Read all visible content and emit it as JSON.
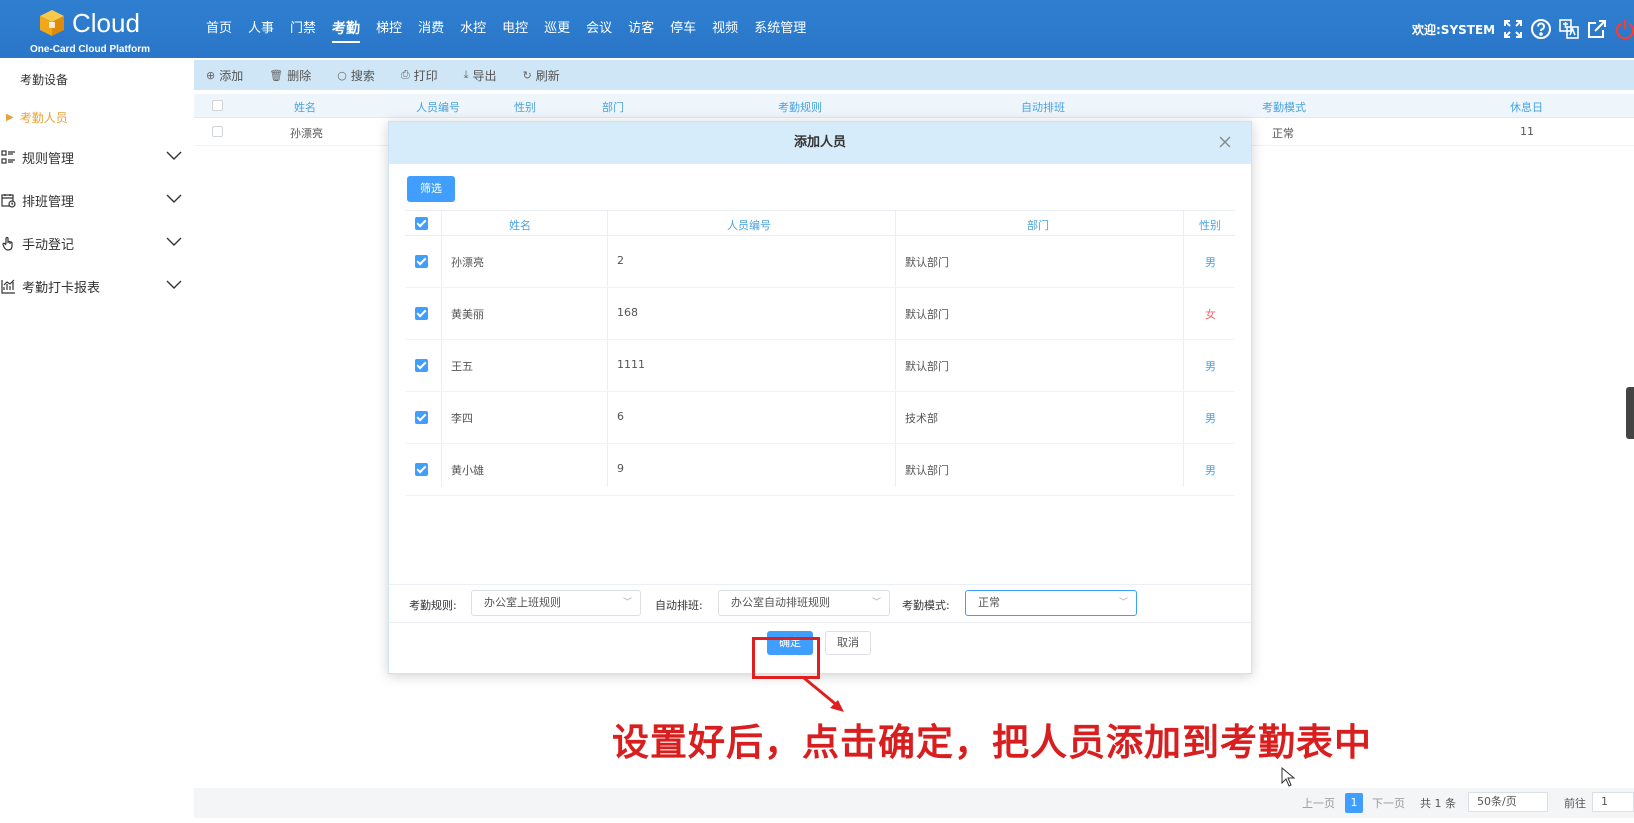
{
  "app": {
    "logo_text": "Cloud",
    "logo_subtitle": "One-Card Cloud Platform",
    "welcome": "欢迎:SYSTEM"
  },
  "nav": {
    "items": [
      "首页",
      "人事",
      "门禁",
      "考勤",
      "梯控",
      "消费",
      "水控",
      "电控",
      "巡更",
      "会议",
      "访客",
      "停车",
      "视频",
      "系统管理"
    ],
    "active": "考勤"
  },
  "header_icons": [
    "fullscreen-icon",
    "help-icon",
    "translate-icon",
    "external-link-icon",
    "power-icon"
  ],
  "sidebar": {
    "items": [
      {
        "label": "考勤设备",
        "type": "sub"
      },
      {
        "label": "考勤人员",
        "type": "sub",
        "active": true
      },
      {
        "label": "规则管理",
        "type": "group",
        "icon": "rules-icon"
      },
      {
        "label": "排班管理",
        "type": "group",
        "icon": "schedule-icon"
      },
      {
        "label": "手动登记",
        "type": "group",
        "icon": "hand-icon"
      },
      {
        "label": "考勤打卡报表",
        "type": "group",
        "icon": "report-chart-icon"
      }
    ]
  },
  "toolbar": {
    "add": "添加",
    "delete": "删除",
    "search": "搜索",
    "print": "打印",
    "export": "导出",
    "refresh": "刷新"
  },
  "grid": {
    "headers": {
      "name": "姓名",
      "id": "人员编号",
      "gender": "性别",
      "dept": "部门",
      "rule": "考勤规则",
      "auto": "自动排班",
      "mode": "考勤模式",
      "rest": "休息日"
    },
    "row": {
      "name": "孙漂亮",
      "mode": "正常",
      "rest": "11"
    }
  },
  "pager": {
    "prev": "上一页",
    "current": "1",
    "next": "下一页",
    "total": "共 1 条",
    "page_size": "50条/页",
    "goto": "前往",
    "goto_value": "1"
  },
  "dialog": {
    "title": "添加人员",
    "filter_button": "筛选",
    "headers": {
      "name": "姓名",
      "id": "人员编号",
      "dept": "部门",
      "gender": "性别"
    },
    "rows": [
      {
        "name": "孙漂亮",
        "id": "2",
        "dept": "默认部门",
        "gender": "男",
        "checked": true
      },
      {
        "name": "黄美丽",
        "id": "168",
        "dept": "默认部门",
        "gender": "女",
        "checked": true
      },
      {
        "name": "王五",
        "id": "1111",
        "dept": "默认部门",
        "gender": "男",
        "checked": true
      },
      {
        "name": "李四",
        "id": "6",
        "dept": "技术部",
        "gender": "男",
        "checked": true
      },
      {
        "name": "黄小雄",
        "id": "9",
        "dept": "默认部门",
        "gender": "男",
        "checked": true
      }
    ],
    "rule_label": "考勤规则:",
    "rule_value": "办公室上班规则",
    "auto_label": "自动排班:",
    "auto_value": "办公室自动排班规则",
    "mode_label": "考勤模式:",
    "mode_value": "正常",
    "ok": "确定",
    "cancel": "取消"
  },
  "annotation": "设置好后，点击确定，把人员添加到考勤表中",
  "colors": {
    "header_blue": "#2f7fd1",
    "primary": "#409eff",
    "active_sidebar": "#e6a23c",
    "annotation_red": "#d81e1e"
  }
}
